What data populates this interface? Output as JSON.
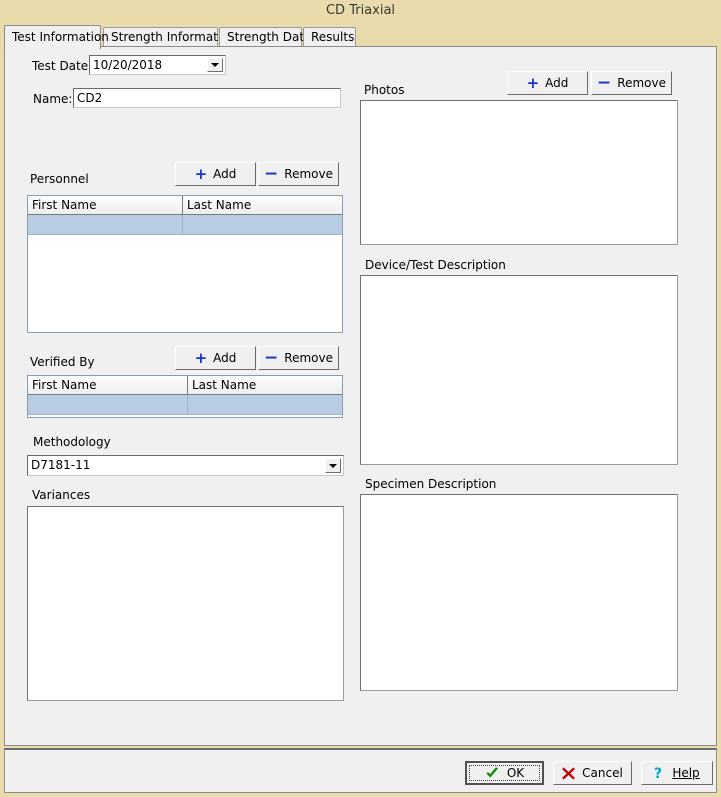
{
  "window": {
    "title": "CD Triaxial",
    "titlebar_color": "#e9dbab",
    "panel_color": "#f0f0f0",
    "selection_color": "#b8cce4",
    "accent_icon_color": "#1433c8"
  },
  "tabs": [
    {
      "label": "Test Information",
      "active": true
    },
    {
      "label": "Strength Information",
      "active": false
    },
    {
      "label": "Strength Data",
      "active": false
    },
    {
      "label": "Results",
      "active": false
    }
  ],
  "left": {
    "test_date": {
      "label": "Test Date:",
      "value": "10/20/2018",
      "icon": "chevron-down-icon"
    },
    "name": {
      "label": "Name:",
      "value": "CD2",
      "placeholder": ""
    },
    "personnel": {
      "label": "Personnel",
      "add_label": "Add",
      "remove_label": "Remove",
      "add_icon": "plus-icon",
      "remove_icon": "minus-icon",
      "columns": [
        "First Name",
        "Last Name"
      ],
      "rows": [
        {
          "first_name": "",
          "last_name": "",
          "selected": true
        }
      ]
    },
    "verified_by": {
      "label": "Verified By",
      "add_label": "Add",
      "remove_label": "Remove",
      "add_icon": "plus-icon",
      "remove_icon": "minus-icon",
      "columns": [
        "First Name",
        "Last Name"
      ],
      "rows": [
        {
          "first_name": "",
          "last_name": "",
          "selected": true
        }
      ]
    },
    "methodology": {
      "label": "Methodology",
      "value": "D7181-11",
      "icon": "chevron-down-icon"
    },
    "variances": {
      "label": "Variances",
      "value": ""
    }
  },
  "right": {
    "photos": {
      "label": "Photos",
      "add_label": "Add",
      "remove_label": "Remove",
      "add_icon": "plus-icon",
      "remove_icon": "minus-icon",
      "value": ""
    },
    "device_test_description": {
      "label": "Device/Test Description",
      "value": ""
    },
    "specimen_description": {
      "label": "Specimen Description",
      "value": ""
    }
  },
  "footer": {
    "ok": {
      "label": "OK",
      "icon": "check-icon",
      "is_default": true
    },
    "cancel": {
      "label": "Cancel",
      "icon": "x-icon"
    },
    "help": {
      "label": "Help",
      "icon": "question-icon",
      "accesskey": "H"
    }
  }
}
